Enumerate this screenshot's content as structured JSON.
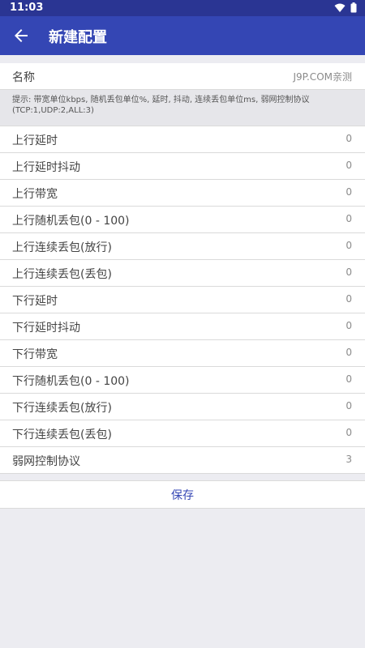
{
  "status": {
    "time": "11:03"
  },
  "appbar": {
    "title": "新建配置"
  },
  "name_row": {
    "label": "名称",
    "value": "J9P.COM亲测"
  },
  "hint": "提示: 带宽单位kbps, 随机丢包单位%, 延时, 抖动, 连续丢包单位ms, 弱网控制协议(TCP:1,UDP:2,ALL:3)",
  "fields": [
    {
      "label": "上行延时",
      "value": "0"
    },
    {
      "label": "上行延时抖动",
      "value": "0"
    },
    {
      "label": "上行带宽",
      "value": "0"
    },
    {
      "label": "上行随机丢包(0 - 100)",
      "value": "0"
    },
    {
      "label": "上行连续丢包(放行)",
      "value": "0"
    },
    {
      "label": "上行连续丢包(丢包)",
      "value": "0"
    },
    {
      "label": "下行延时",
      "value": "0"
    },
    {
      "label": "下行延时抖动",
      "value": "0"
    },
    {
      "label": "下行带宽",
      "value": "0"
    },
    {
      "label": "下行随机丢包(0 - 100)",
      "value": "0"
    },
    {
      "label": "下行连续丢包(放行)",
      "value": "0"
    },
    {
      "label": "下行连续丢包(丢包)",
      "value": "0"
    },
    {
      "label": "弱网控制协议",
      "value": "3"
    }
  ],
  "actions": {
    "save_label": "保存"
  },
  "colors": {
    "app_bar": "#3446b4",
    "status_bar": "#2a3593",
    "accent": "#3446b4"
  }
}
